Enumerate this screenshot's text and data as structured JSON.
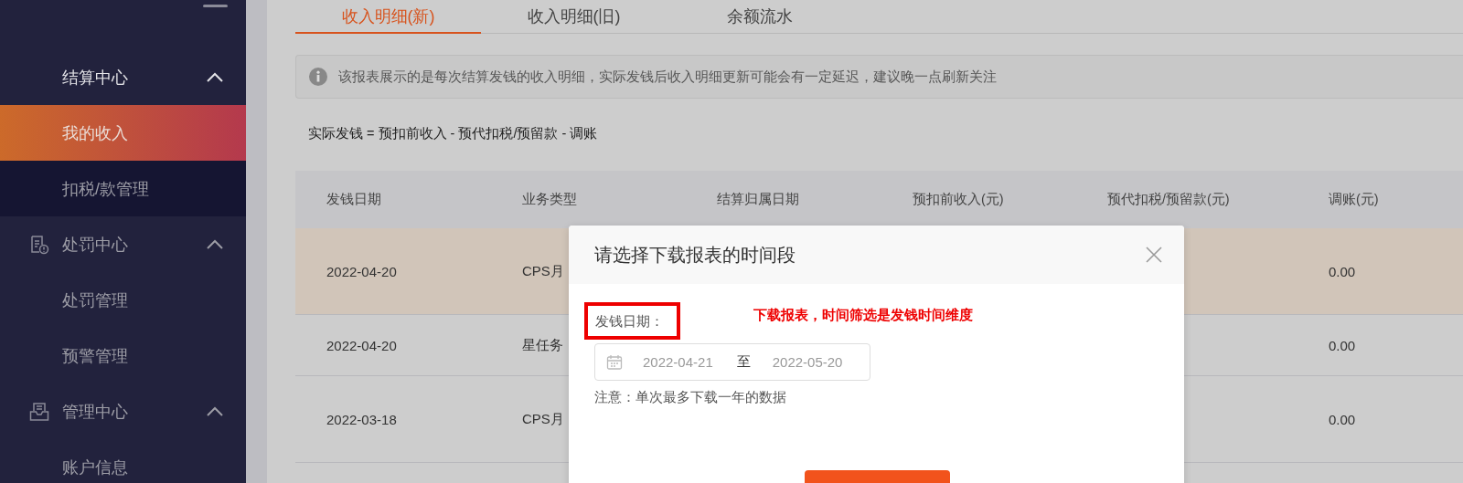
{
  "sidebar": {
    "sections": [
      {
        "label": "结算中心",
        "expanded": true,
        "children": [
          {
            "label": "我的收入",
            "selected": true
          },
          {
            "label": "扣税/款管理",
            "selected": false
          }
        ]
      },
      {
        "label": "处罚中心",
        "expanded": true,
        "children": [
          {
            "label": "处罚管理",
            "selected": false
          },
          {
            "label": "预警管理",
            "selected": false
          }
        ]
      },
      {
        "label": "管理中心",
        "expanded": true,
        "children": [
          {
            "label": "账户信息",
            "selected": false
          }
        ]
      }
    ]
  },
  "tabs": [
    {
      "label": "收入明细(新)",
      "selected": true
    },
    {
      "label": "收入明细(旧)",
      "selected": false
    },
    {
      "label": "余额流水",
      "selected": false
    }
  ],
  "notice": "该报表展示的是每次结算发钱的收入明细，实际发钱后收入明细更新可能会有一定延迟，建议晚一点刷新关注",
  "formula": "实际发钱 = 预扣前收入 - 预代扣税/预留款 - 调账",
  "table": {
    "columns": [
      "发钱日期",
      "业务类型",
      "结算归属日期",
      "预扣前收入(元)",
      "预代扣税/预留款(元)",
      "调账(元)"
    ],
    "rows": [
      {
        "date": "2022-04-20",
        "type": "CPS月",
        "adjustment": "0.00",
        "highlighted": true
      },
      {
        "date": "2022-04-20",
        "type": "星任务",
        "adjustment": "0.00",
        "highlighted": false
      },
      {
        "date": "2022-03-18",
        "type": "CPS月",
        "adjustment": "0.00",
        "highlighted": false
      }
    ]
  },
  "modal": {
    "title": "请选择下载报表的时间段",
    "label": "发钱日期：",
    "annotation": "下载报表，时间筛选是发钱时间维度",
    "start_date": "2022-04-21",
    "separator": "至",
    "end_date": "2022-05-20",
    "note": "注意：单次最多下载一年的数据"
  }
}
